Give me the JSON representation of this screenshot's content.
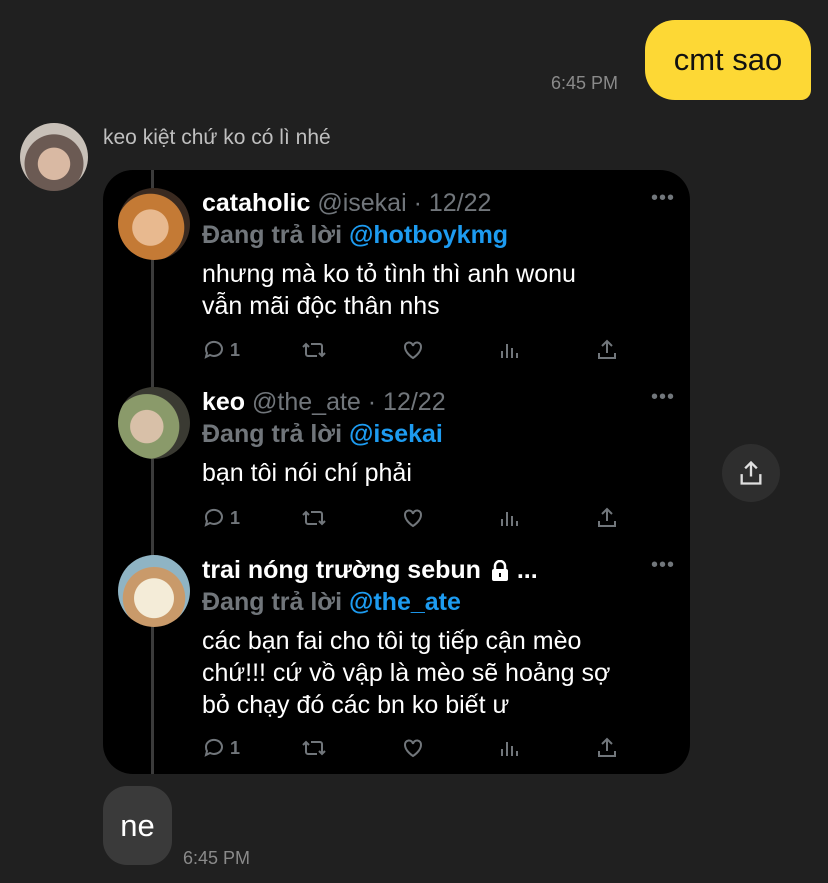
{
  "outgoing": {
    "text": "cmt sao",
    "time": "6:45 PM"
  },
  "incoming": {
    "sender": "keo kiệt chứ ko có lì nhé",
    "tweets": [
      {
        "name": "cataholic",
        "handle": "@isekai · 12/22",
        "reply_prefix": "Đang trả lời",
        "reply_to": "@hotboykmg",
        "lines": [
          "nhưng mà ko tỏ tình thì anh wonu",
          "vẫn mãi độc thân nhs"
        ],
        "reply_count": "1",
        "more": "•••"
      },
      {
        "name": "keo",
        "handle": "@the_ate · 12/22",
        "reply_prefix": "Đang trả lời",
        "reply_to": "@isekai",
        "lines": [
          "bạn tôi nói chí phải"
        ],
        "reply_count": "1",
        "more": "•••"
      },
      {
        "name": "trai nóng trường sebun",
        "handle": "...",
        "reply_prefix": "Đang trả lời",
        "reply_to": "@the_ate",
        "lines": [
          "các bạn fai cho tôi tg tiếp cận mèo",
          "chứ!!! cứ vồ vập là mèo sẽ hoảng sợ",
          "bỏ chạy đó các bn ko biết ư"
        ],
        "reply_count": "1",
        "more": "•••"
      }
    ],
    "reply_text": "ne",
    "time": "6:45 PM"
  },
  "icons": {
    "reply": "comment-icon",
    "retweet": "retweet-icon",
    "like": "heart-icon",
    "views": "views-icon",
    "share": "share-icon",
    "lock": "lock-icon"
  },
  "colors": {
    "outgoing_bubble": "#fdd835",
    "mention": "#1d9bf0"
  }
}
